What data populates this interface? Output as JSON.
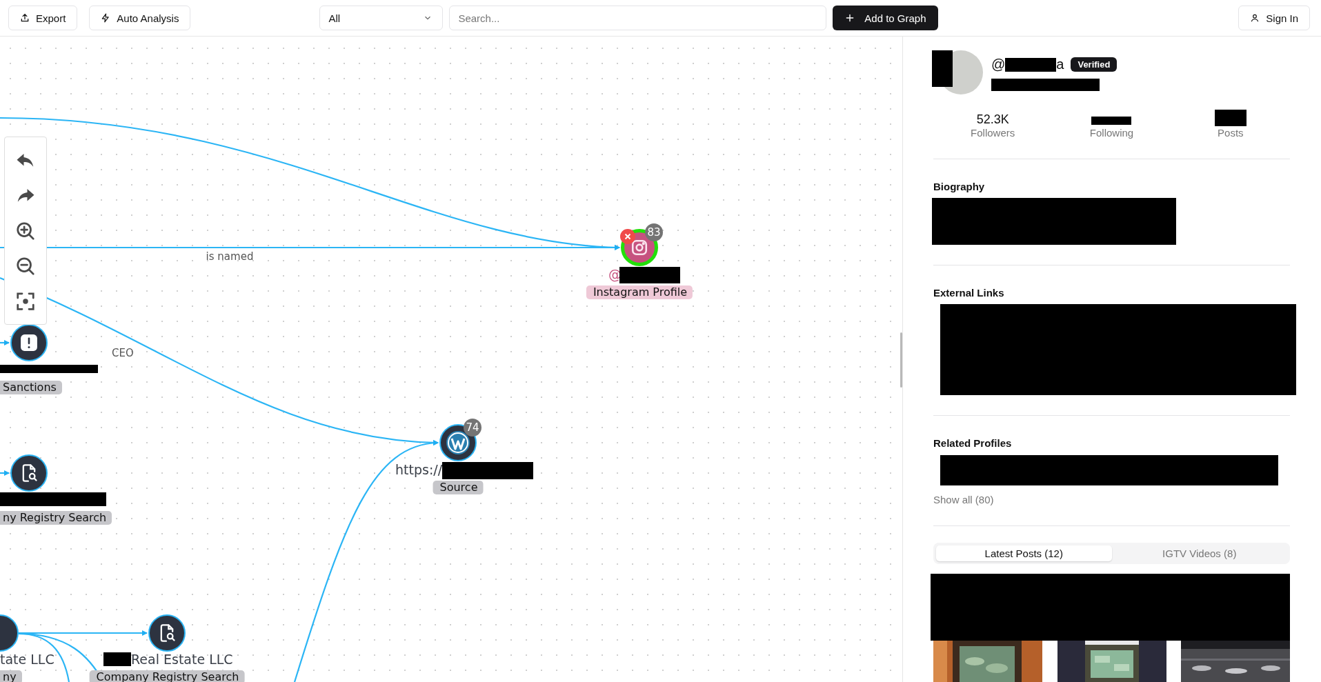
{
  "toolbar": {
    "buttons": [
      {
        "label": "Export",
        "kind": "export"
      },
      {
        "label": "Auto Analysis",
        "kind": "analysis"
      }
    ],
    "filter": {
      "value": "All"
    },
    "search": {
      "placeholder": "Search..."
    },
    "add_button": "Add to Graph",
    "sign_in": "Sign In"
  },
  "graph": {
    "edges": [
      {
        "label": "is named"
      },
      {
        "label": "CEO"
      }
    ],
    "nodes": [
      {
        "kind": "instagram",
        "label": "@",
        "tag": "Instagram Profile",
        "badge": "83",
        "selected": true
      },
      {
        "kind": "wordpress",
        "label": "https://",
        "tag": "Source",
        "badge": "74",
        "selected": false
      },
      {
        "kind": "sanctions",
        "tag": "Sanctions",
        "selected": false
      },
      {
        "kind": "registry",
        "tag": "ny Registry Search",
        "selected": false
      },
      {
        "kind": "company",
        "label": "tate LLC",
        "tag": "ny",
        "selected": false
      },
      {
        "kind": "registry",
        "label": "Real Estate LLC",
        "tag": "Company Registry Search",
        "selected": false
      }
    ]
  },
  "profile": {
    "handle_prefix": "@",
    "handle_suffix": "a",
    "badge": "Verified",
    "stats": [
      {
        "value": "52.3K",
        "label": "Followers"
      },
      {
        "label": "Following"
      },
      {
        "label": "Posts"
      }
    ],
    "sections": [
      "Biography",
      "External Links",
      "Related Profiles"
    ],
    "show_all": "Show all (80)",
    "tabs": [
      {
        "label": "Latest Posts (12)",
        "selected": true
      },
      {
        "label": "IGTV Videos (8)",
        "selected": false
      }
    ]
  }
}
